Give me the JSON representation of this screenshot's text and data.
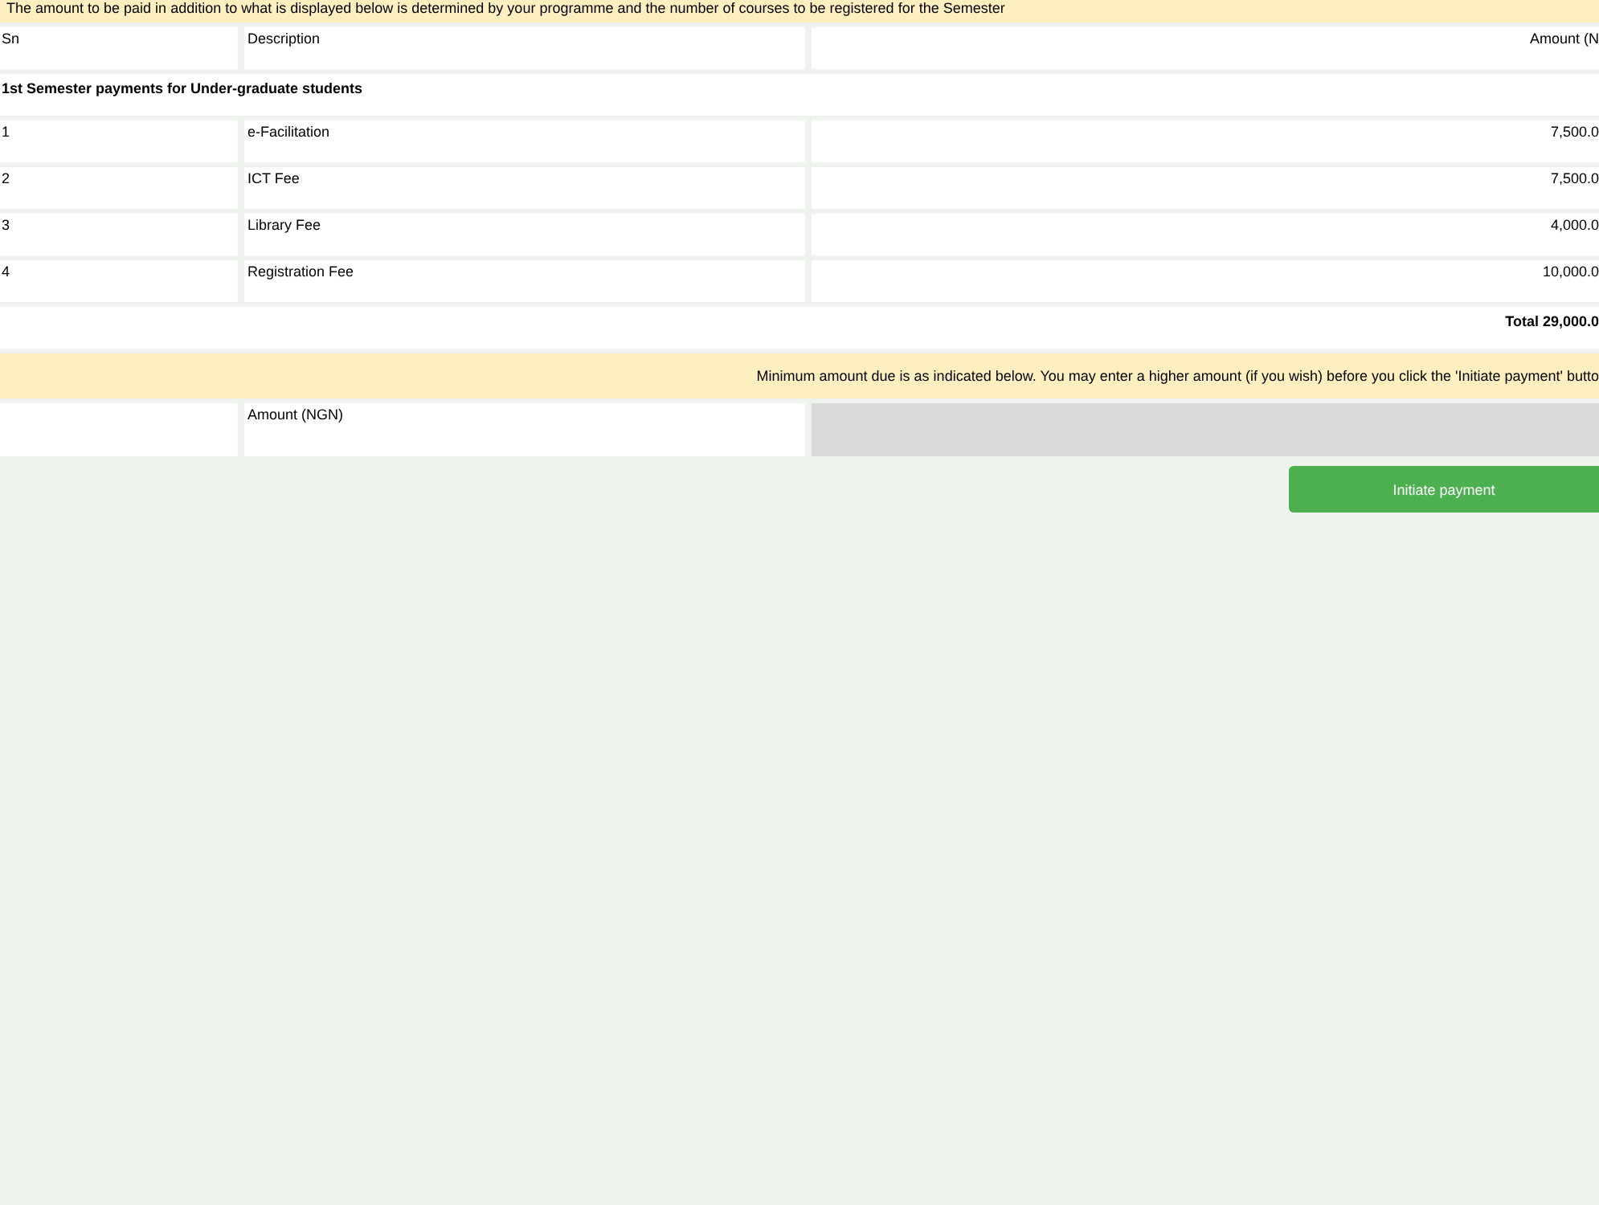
{
  "notice": "The amount to be paid in addition to what is displayed below is determined by your programme and the number of courses to be registered for the Semester",
  "table": {
    "columns": [
      "Sn",
      "Description",
      "Amount (N"
    ],
    "section": "1st Semester payments for Under-graduate students",
    "rows": [
      {
        "sn": "1",
        "description": "e-Facilitation",
        "amount": "7,500.0"
      },
      {
        "sn": "2",
        "description": "ICT Fee",
        "amount": "7,500.0"
      },
      {
        "sn": "3",
        "description": "Library Fee",
        "amount": "4,000.0"
      },
      {
        "sn": "4",
        "description": "Registration Fee",
        "amount": "10,000.0"
      }
    ],
    "total": "Total 29,000.0"
  },
  "minimum_notice": "Minimum amount due is as indicated below. You may enter a higher amount (if you wish) before you click the 'Initiate payment' butto",
  "amount_field": {
    "label": "Amount (NGN)",
    "disabled": true
  },
  "button": "Initiate payment"
}
